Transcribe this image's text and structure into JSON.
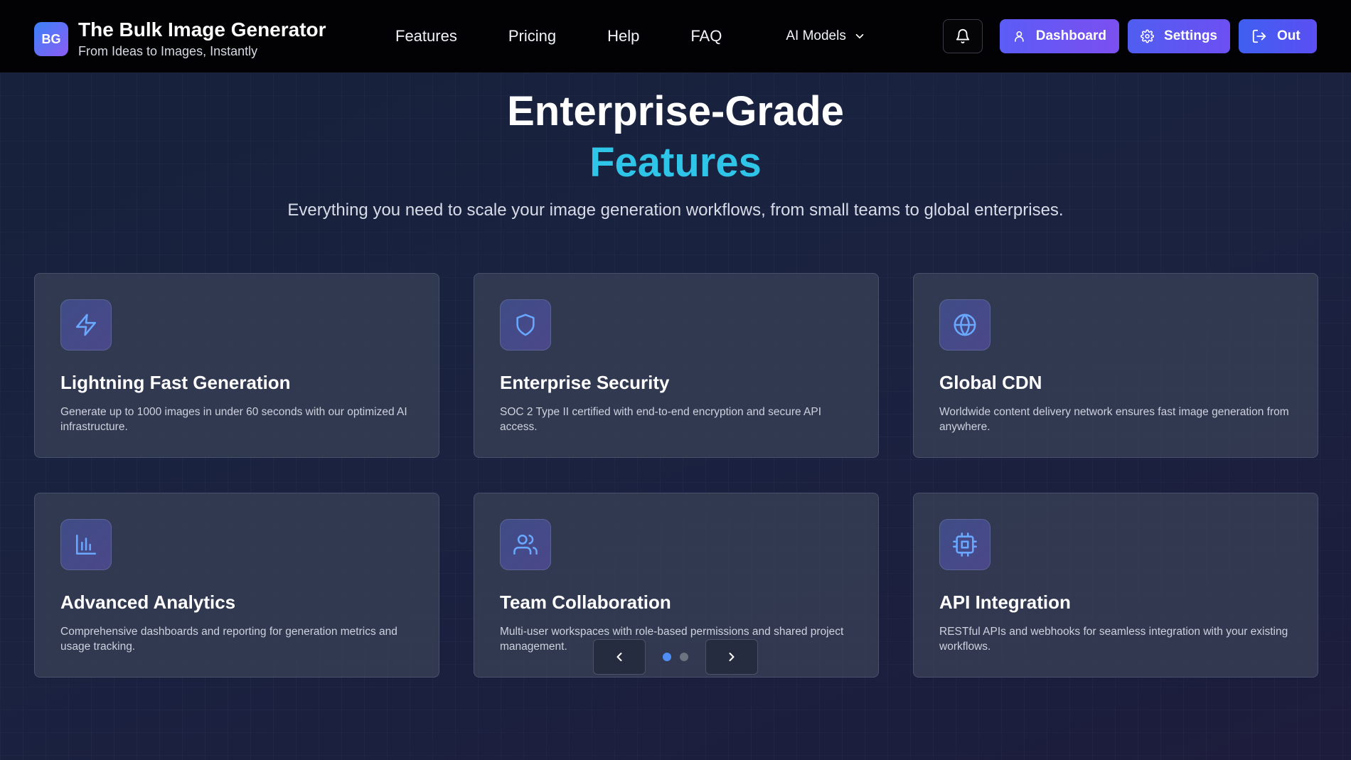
{
  "brand": {
    "logo": "BG",
    "title": "The Bulk Image Generator",
    "subtitle": "From Ideas to Images, Instantly"
  },
  "nav": {
    "links": [
      "Features",
      "Pricing",
      "Help",
      "FAQ"
    ],
    "models_label": "AI Models"
  },
  "actions": {
    "dashboard": "Dashboard",
    "settings": "Settings",
    "out": "Out"
  },
  "hero": {
    "title": "Enterprise-Grade",
    "accent": "Features",
    "description": "Everything you need to scale your image generation workflows, from small teams to global enterprises."
  },
  "cards": [
    {
      "icon": "lightning-icon",
      "title": "Lightning Fast Generation",
      "desc": "Generate up to 1000 images in under 60 seconds with our optimized AI infrastructure."
    },
    {
      "icon": "shield-icon",
      "title": "Enterprise Security",
      "desc": "SOC 2 Type II certified with end-to-end encryption and secure API access."
    },
    {
      "icon": "globe-icon",
      "title": "Global CDN",
      "desc": "Worldwide content delivery network ensures fast image generation from anywhere."
    },
    {
      "icon": "bar-chart-icon",
      "title": "Advanced Analytics",
      "desc": "Comprehensive dashboards and reporting for generation metrics and usage tracking."
    },
    {
      "icon": "users-icon",
      "title": "Team Collaboration",
      "desc": "Multi-user workspaces with role-based permissions and shared project management."
    },
    {
      "icon": "cpu-icon",
      "title": "API Integration",
      "desc": "RESTful APIs and webhooks for seamless integration with your existing workflows."
    }
  ],
  "pagination": {
    "pages": 2,
    "current": 1
  },
  "colors": {
    "accent": "#2ec5e8",
    "icon_stroke": "#6aa8ff",
    "dot_active": "#4f8ef5",
    "dot_inactive": "#6b7280"
  }
}
